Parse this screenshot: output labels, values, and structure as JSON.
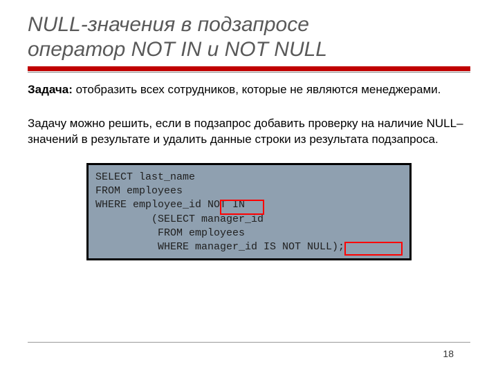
{
  "title_line1": "NULL-значения в подзапросе",
  "title_line2": "оператор NOT IN и NOT NULL",
  "task": {
    "label": "Задача:",
    "text": " отобразить всех сотрудников, которые не являются менеджерами."
  },
  "explain": "Задачу можно решить, если в подзапрос добавить проверку на наличие NULL–значений в результате и удалить данные строки из результата подзапроса.",
  "code": {
    "l1": "SELECT last_name",
    "l2": "FROM employees",
    "l3": "WHERE employee_id NOT IN",
    "l4": "         (SELECT manager_id",
    "l5": "          FROM employees",
    "l6": "          WHERE manager_id IS NOT NULL);"
  },
  "page_number": "18"
}
